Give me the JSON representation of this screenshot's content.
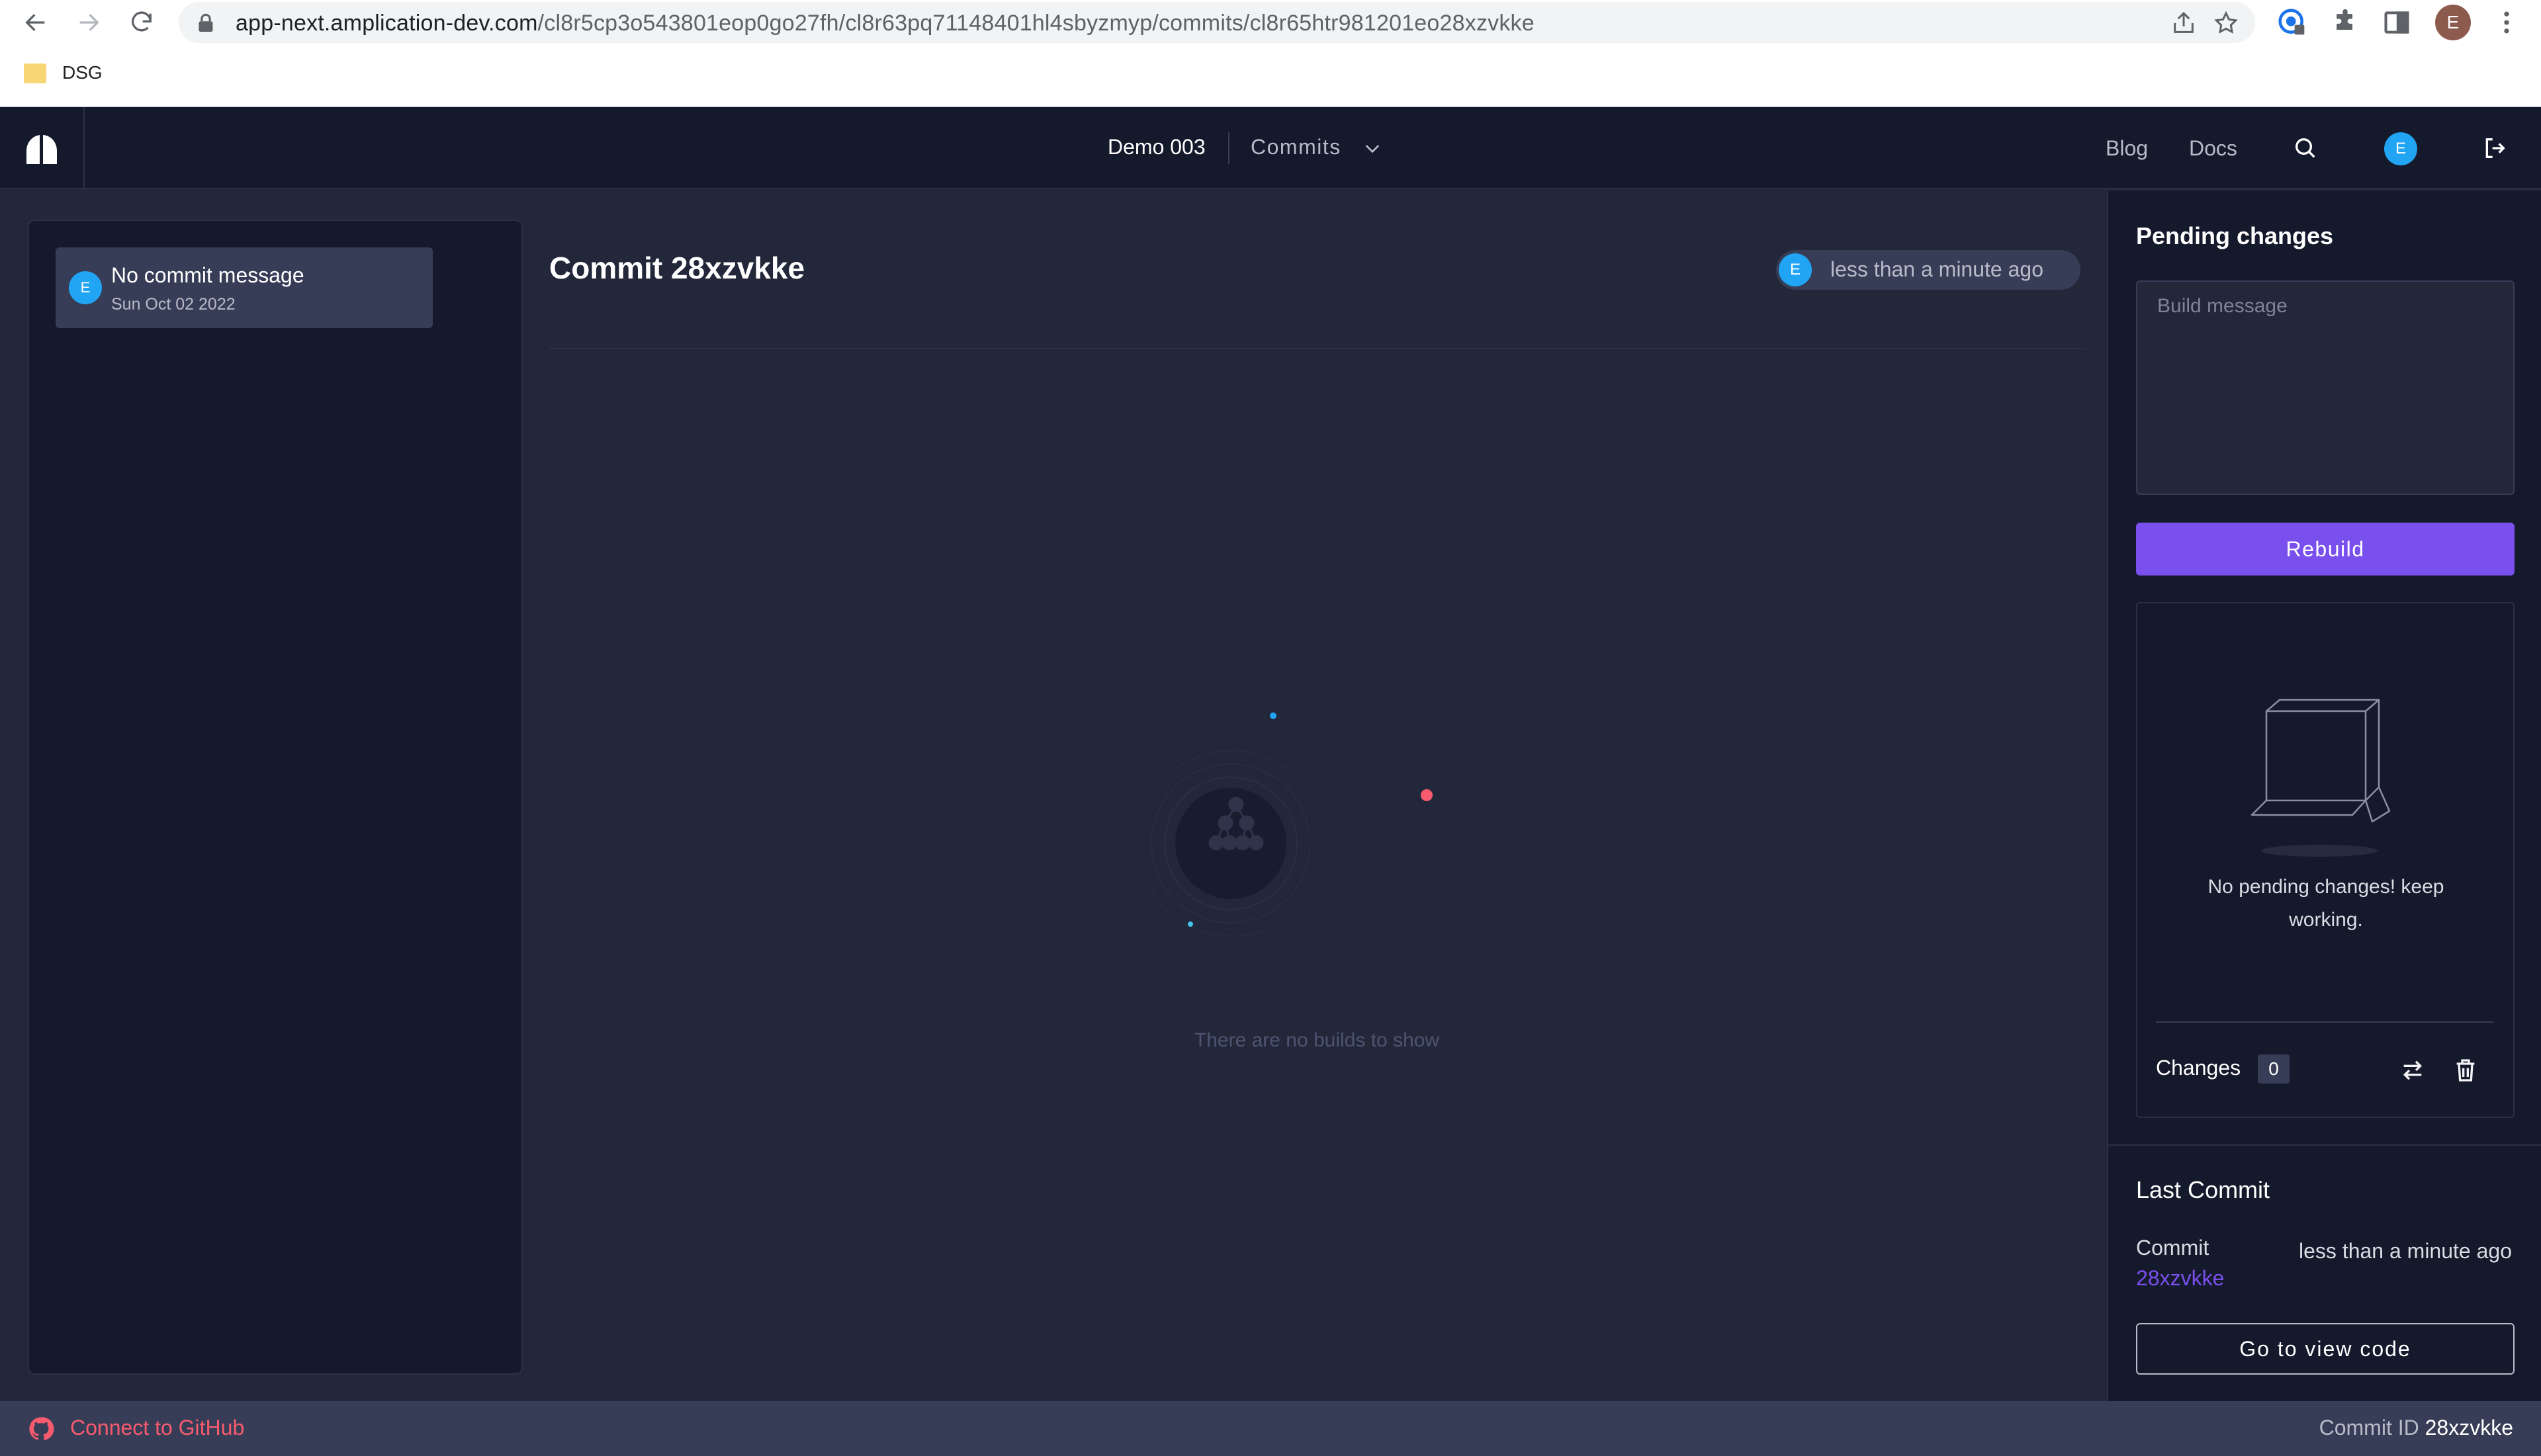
{
  "browser": {
    "url_host": "app-next.amplication-dev.com",
    "url_path": "/cl8r5cp3o543801eop0go27fh/cl8r63pq71148401hl4sbyzmyp/commits/cl8r65htr981201eo28xzvkke",
    "profile_initial": "E",
    "bookmarks": [
      {
        "label": "DSG"
      }
    ]
  },
  "header": {
    "project_name": "Demo 003",
    "section_label": "Commits",
    "links": [
      {
        "label": "Blog"
      },
      {
        "label": "Docs"
      }
    ],
    "user_initial": "E"
  },
  "commits_list": [
    {
      "avatar_initial": "E",
      "message": "No commit message",
      "date": "Sun Oct 02 2022"
    }
  ],
  "main": {
    "title": "Commit 28xzvkke",
    "time_chip": {
      "avatar_initial": "E",
      "text": "less than a minute ago"
    },
    "empty_message": "There are no builds to show"
  },
  "pending_panel": {
    "heading": "Pending changes",
    "build_message_placeholder": "Build message",
    "rebuild_label": "Rebuild",
    "empty_message": "No pending changes! keep working.",
    "changes_label": "Changes",
    "changes_count": "0"
  },
  "last_commit": {
    "heading": "Last Commit",
    "commit_label": "Commit",
    "commit_id": "28xzvkke",
    "time": "less than a minute ago",
    "view_code_label": "Go to view code"
  },
  "status_bar": {
    "github_label": "Connect to GitHub",
    "commit_id_label": "Commit ID",
    "commit_id": "28xzvkke"
  },
  "colors": {
    "accent": "#7950ed",
    "avatar": "#20a4f3",
    "github_link": "#f85b6e",
    "background": "#22273a",
    "panel": "#15192c"
  }
}
